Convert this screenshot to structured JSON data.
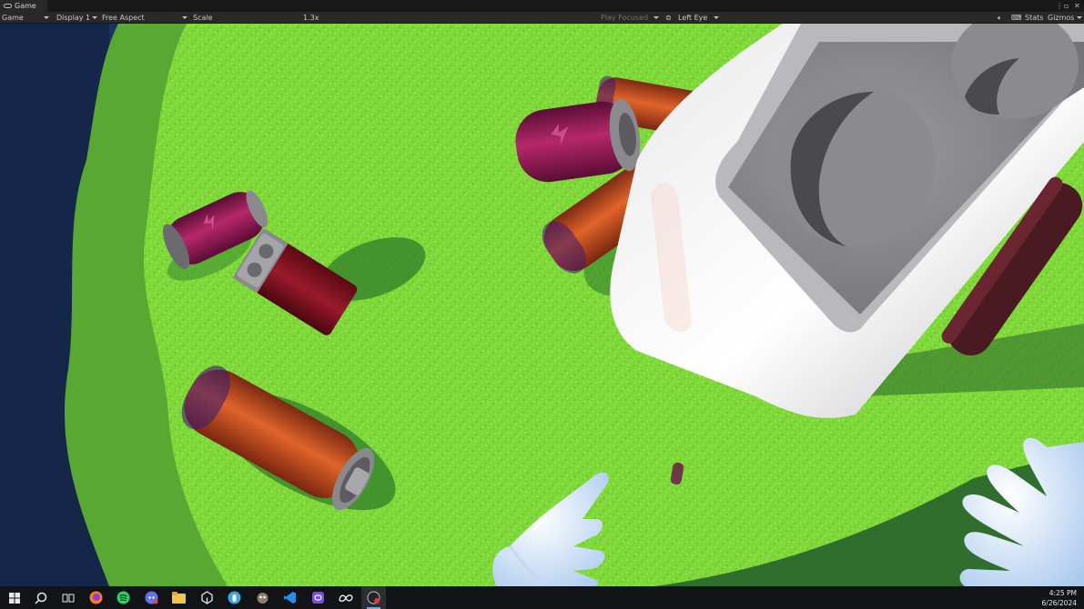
{
  "window": {
    "tab_title": "Game"
  },
  "toolbar": {
    "game_view": "Game",
    "display": "Display 1",
    "aspect": "Free Aspect",
    "scale_label": "Scale",
    "scale_value": "1.3x",
    "play_mode": "Play Focused",
    "eye": "Left Eye",
    "stats": "Stats",
    "gizmos": "Gizmos"
  },
  "taskbar": {
    "apps": [
      "start-icon",
      "search-icon",
      "task-view-icon",
      "firefox-icon",
      "spotify-icon",
      "discord-icon",
      "file-explorer-icon",
      "unity-icon",
      "vr-app-icon",
      "gimp-icon",
      "vscode-icon",
      "oculus-icon",
      "meta-icon",
      "recorder-icon"
    ],
    "time": "4:25 PM",
    "date": "6/26/2024"
  },
  "colors": {
    "grass": "#7fd83a",
    "water": "#1b2f5a",
    "editor_bg": "#282828",
    "taskbar_bg": "#111317"
  }
}
